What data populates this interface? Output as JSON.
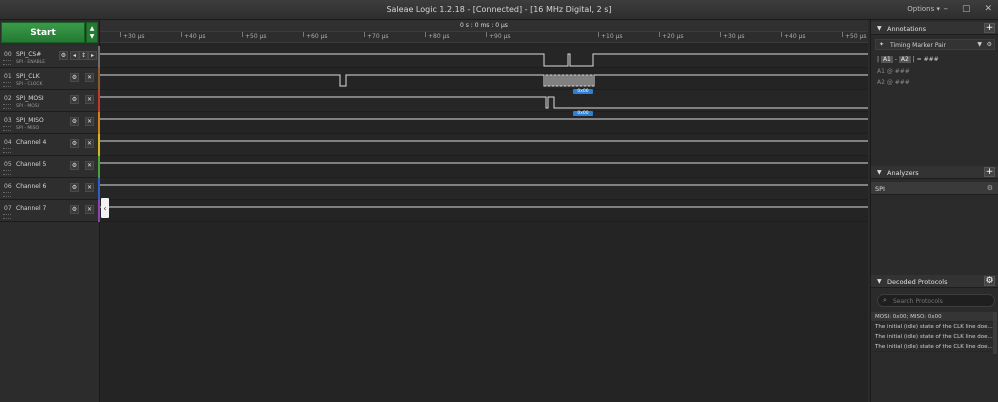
{
  "window": {
    "title": "Saleae Logic 1.2.18 - [Connected] - [16 MHz Digital, 2 s]",
    "options_label": "Options ▾",
    "minimize": "–",
    "maximize": "▢",
    "close": "✕"
  },
  "toolbar": {
    "start_label": "Start",
    "arrows": "▲▼"
  },
  "timeline": {
    "center_time": "0 s : 0 ms : 0 μs",
    "ticks": [
      "+30 μs",
      "+40 μs",
      "+50 μs",
      "+60 μs",
      "+70 μs",
      "+80 μs",
      "+90 μs",
      "+10 μs",
      "+20 μs",
      "+30 μs",
      "+40 μs",
      "+50 μs"
    ]
  },
  "channels": [
    {
      "num": "00",
      "name": "SPI_CS#",
      "sub": "SPI - ENABLE",
      "color": "#6e6e6e"
    },
    {
      "num": "01",
      "name": "SPI_CLK",
      "sub": "SPI - CLOCK",
      "color": "#8a5a2b"
    },
    {
      "num": "02",
      "name": "SPI_MOSI",
      "sub": "SPI - MOSI",
      "color": "#c0392b"
    },
    {
      "num": "03",
      "name": "SPI_MISO",
      "sub": "SPI - MISO",
      "color": "#d4801e"
    },
    {
      "num": "04",
      "name": "Channel 4",
      "sub": "",
      "color": "#d4b81e"
    },
    {
      "num": "05",
      "name": "Channel 5",
      "sub": "",
      "color": "#4aa33a"
    },
    {
      "num": "06",
      "name": "Channel 6",
      "sub": "",
      "color": "#2f5fc4"
    },
    {
      "num": "07",
      "name": "Channel 7",
      "sub": "",
      "color": "#8e44ad"
    }
  ],
  "channel_buttons": {
    "gear": "⚙",
    "close": "✕",
    "prev": "◂",
    "edge": "↕",
    "next": "▸"
  },
  "decoded_badges": {
    "mosi": "0x00",
    "miso": "0x00"
  },
  "marker": {
    "glyph": "‹"
  },
  "annotations": {
    "title": "Annotations",
    "add": "+",
    "item_label": "Timing Marker Pair",
    "formula_open": "|",
    "a1": "A1",
    "dash": "-",
    "a2": "A2",
    "formula_close": "| = ###",
    "line_a1": "A1  @  ###",
    "line_a2": "A2  @  ###"
  },
  "analyzers": {
    "title": "Analyzers",
    "add": "+",
    "items": [
      {
        "label": "SPI"
      }
    ]
  },
  "decoded_protocols": {
    "title": "Decoded Protocols",
    "add": "⚙",
    "search_placeholder": "Search Protocols",
    "items": [
      "MOSI: 0x00;  MISO: 0x00",
      "The initial (idle) state of the CLK line doe...",
      "The initial (idle) state of the CLK line doe...",
      "The initial (idle) state of the CLK line doe..."
    ]
  },
  "icons": {
    "collapse": "▼",
    "pin": "📌",
    "filter": "▼",
    "gear": "⚙",
    "search": "⌕"
  }
}
